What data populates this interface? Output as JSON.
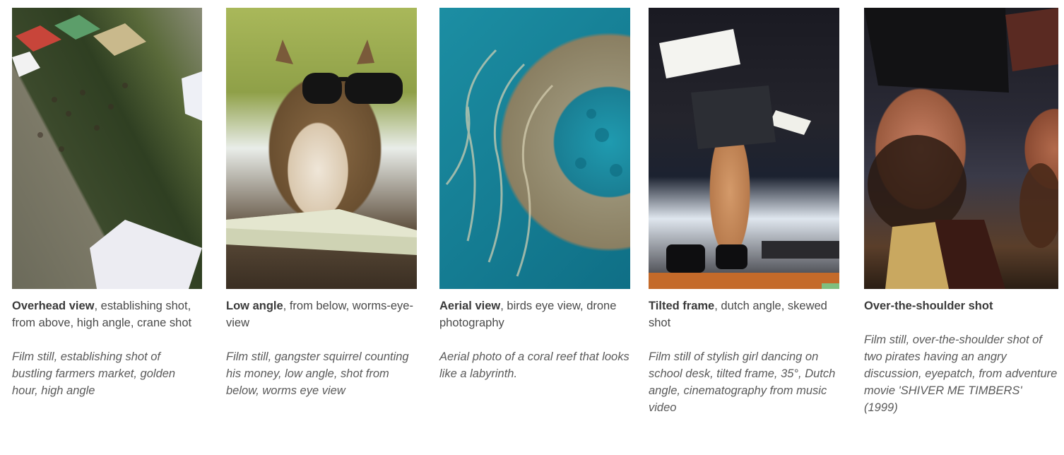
{
  "cards": [
    {
      "title": "Overhead view",
      "rest": ", establishing shot, from above, high angle, crane shot",
      "prompt": "Film still, establishing shot of bustling farmers market, golden hour, high angle"
    },
    {
      "title": "Low angle",
      "rest": ", from below, worms-eye-view",
      "prompt": "Film still, gangster squirrel counting his money, low angle, shot from below, worms eye view"
    },
    {
      "title": "Aerial view",
      "rest": ", birds eye view, drone photography",
      "prompt": "Aerial photo of a coral reef that looks like a labyrinth."
    },
    {
      "title": "Tilted frame",
      "rest": ", dutch angle, skewed shot",
      "prompt": "Film still of stylish girl dancing on school desk, tilted frame, 35°, Dutch angle, cinematography from music video"
    },
    {
      "title": "Over-the-shoulder shot",
      "rest": "",
      "prompt": "Film still, over-the-shoulder shot of two pirates having an angry discussion, eyepatch, from adventure movie 'SHIVER ME TIMBERS' (1999)"
    }
  ]
}
